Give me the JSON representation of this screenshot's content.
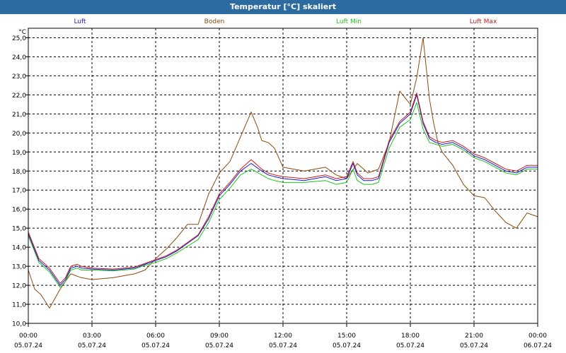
{
  "window": {
    "title": "Temperatur [°C] skaliert"
  },
  "chart_data": {
    "type": "line",
    "ylabel": "°C",
    "ylim": [
      10.0,
      25.5
    ],
    "xlim": [
      0,
      24
    ],
    "grid": true,
    "legend_placement": "top",
    "y_ticks": [
      "10,0",
      "11,0",
      "12,0",
      "13,0",
      "14,0",
      "15,0",
      "16,0",
      "17,0",
      "18,0",
      "19,0",
      "20,0",
      "21,0",
      "22,0",
      "23,0",
      "24,0",
      "25,0"
    ],
    "x_ticks": [
      {
        "time": "00:00",
        "date": "05.07.24"
      },
      {
        "time": "03:00",
        "date": "05.07.24"
      },
      {
        "time": "06:00",
        "date": "05.07.24"
      },
      {
        "time": "09:00",
        "date": "05.07.24"
      },
      {
        "time": "12:00",
        "date": "05.07.24"
      },
      {
        "time": "15:00",
        "date": "05.07.24"
      },
      {
        "time": "18:00",
        "date": "05.07.24"
      },
      {
        "time": "21:00",
        "date": "05.07.24"
      },
      {
        "time": "00:00",
        "date": "06.07.24"
      }
    ],
    "series": [
      {
        "name": "Luft",
        "color": "#1a1acc",
        "x": [
          0,
          0.5,
          1,
          1.5,
          1.75,
          2,
          2.3,
          2.5,
          3,
          4,
          5,
          5.5,
          6,
          6.5,
          7,
          8,
          8.5,
          9,
          9.5,
          10,
          10.5,
          11,
          11.3,
          11.6,
          12,
          13,
          14,
          14.5,
          15,
          15.3,
          15.5,
          15.8,
          16.2,
          16.5,
          17,
          17.5,
          18,
          18.3,
          18.6,
          18.9,
          19.2,
          19.5,
          20,
          20.5,
          21,
          21.5,
          22,
          22.5,
          23,
          23.5,
          24
        ],
        "y": [
          14.7,
          13.3,
          12.8,
          12.0,
          12.3,
          12.9,
          13.0,
          12.9,
          12.85,
          12.8,
          12.9,
          13.1,
          13.3,
          13.5,
          13.8,
          14.6,
          15.5,
          16.7,
          17.3,
          18.0,
          18.4,
          18.0,
          17.8,
          17.7,
          17.6,
          17.5,
          17.7,
          17.5,
          17.6,
          18.4,
          17.8,
          17.5,
          17.5,
          17.6,
          19.5,
          20.5,
          21.0,
          22.0,
          20.5,
          19.7,
          19.5,
          19.4,
          19.5,
          19.2,
          18.8,
          18.6,
          18.3,
          18.0,
          17.9,
          18.2,
          18.2
        ]
      },
      {
        "name": "Boden",
        "color": "#8b4a0a",
        "x": [
          0,
          0.3,
          0.6,
          1,
          1.2,
          1.5,
          2,
          2.5,
          3,
          4,
          5,
          5.5,
          6,
          6.5,
          7,
          7.5,
          8,
          8.5,
          9,
          9.5,
          10,
          10.5,
          10.8,
          11,
          11.3,
          11.6,
          12,
          12.5,
          13,
          14,
          14.5,
          15,
          15.5,
          16,
          16.5,
          17,
          17.5,
          18,
          18.3,
          18.6,
          18.9,
          19.1,
          19.3,
          19.5,
          20,
          20.5,
          21,
          21.5,
          22,
          22.5,
          23,
          23.5,
          24
        ],
        "y": [
          12.8,
          11.8,
          11.5,
          10.8,
          11.2,
          11.8,
          12.6,
          12.4,
          12.3,
          12.4,
          12.6,
          12.8,
          13.4,
          13.9,
          14.5,
          15.2,
          15.2,
          16.8,
          17.9,
          18.5,
          19.8,
          21.1,
          20.3,
          19.6,
          19.5,
          19.2,
          18.2,
          18.1,
          18.0,
          18.2,
          17.8,
          17.6,
          18.4,
          17.9,
          18.1,
          19.5,
          22.2,
          21.5,
          22.9,
          25.0,
          21.8,
          20.5,
          19.5,
          19.0,
          18.3,
          17.3,
          16.7,
          16.6,
          15.9,
          15.3,
          15.0,
          15.8,
          15.6
        ]
      },
      {
        "name": "Luft Min",
        "color": "#1cc41c",
        "x": [
          0,
          0.5,
          1,
          1.5,
          1.75,
          2,
          2.3,
          2.5,
          3,
          4,
          5,
          5.5,
          6,
          6.5,
          7,
          8,
          8.5,
          9,
          9.5,
          10,
          10.5,
          11,
          11.3,
          11.6,
          12,
          13,
          14,
          14.5,
          15,
          15.3,
          15.5,
          15.8,
          16.2,
          16.5,
          17,
          17.5,
          18,
          18.3,
          18.6,
          18.9,
          19.2,
          19.5,
          20,
          20.5,
          21,
          21.5,
          22,
          22.5,
          23,
          23.5,
          24
        ],
        "y": [
          14.6,
          13.2,
          12.7,
          11.9,
          12.2,
          12.8,
          12.9,
          12.8,
          12.8,
          12.75,
          12.85,
          13.05,
          13.2,
          13.4,
          13.7,
          14.4,
          15.3,
          16.5,
          17.1,
          17.8,
          18.1,
          17.8,
          17.6,
          17.5,
          17.4,
          17.4,
          17.5,
          17.3,
          17.4,
          18.1,
          17.5,
          17.3,
          17.3,
          17.4,
          19.2,
          20.3,
          20.7,
          21.6,
          20.2,
          19.5,
          19.4,
          19.3,
          19.4,
          19.1,
          18.7,
          18.5,
          18.2,
          17.9,
          17.8,
          18.1,
          18.1
        ]
      },
      {
        "name": "Luft Max",
        "color": "#c41c1c",
        "x": [
          0,
          0.5,
          1,
          1.5,
          1.75,
          2,
          2.3,
          2.5,
          3,
          4,
          5,
          5.5,
          6,
          6.5,
          7,
          8,
          8.5,
          9,
          9.5,
          10,
          10.5,
          11,
          11.3,
          11.6,
          12,
          13,
          14,
          14.5,
          15,
          15.3,
          15.5,
          15.8,
          16.2,
          16.5,
          17,
          17.5,
          18,
          18.3,
          18.6,
          18.9,
          19.2,
          19.5,
          20,
          20.5,
          21,
          21.5,
          22,
          22.5,
          23,
          23.5,
          24
        ],
        "y": [
          14.8,
          13.4,
          12.9,
          12.1,
          12.4,
          13.0,
          13.1,
          13.0,
          12.9,
          12.85,
          12.95,
          13.15,
          13.35,
          13.55,
          13.85,
          14.65,
          15.6,
          16.8,
          17.4,
          18.1,
          18.6,
          18.1,
          17.9,
          17.8,
          17.7,
          17.6,
          17.8,
          17.6,
          17.7,
          18.5,
          17.9,
          17.6,
          17.6,
          17.7,
          19.6,
          20.6,
          21.1,
          22.1,
          20.6,
          19.8,
          19.6,
          19.5,
          19.6,
          19.3,
          18.9,
          18.7,
          18.4,
          18.1,
          18.0,
          18.3,
          18.3
        ]
      }
    ]
  }
}
